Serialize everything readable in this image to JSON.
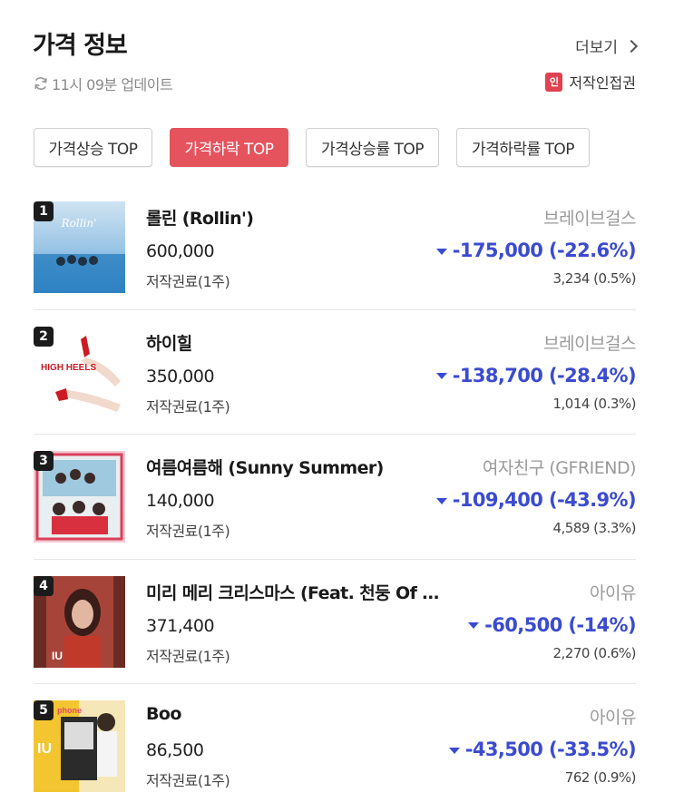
{
  "header": {
    "title": "가격 정보",
    "more_label": "더보기"
  },
  "update": {
    "text": "11시 09분 업데이트",
    "icon": "refresh-icon"
  },
  "copyright": {
    "badge": "인",
    "label": "저작인접권"
  },
  "tabs": [
    {
      "label": "가격상승 TOP",
      "active": false
    },
    {
      "label": "가격하락 TOP",
      "active": true
    },
    {
      "label": "가격상승률 TOP",
      "active": false
    },
    {
      "label": "가격하락률 TOP",
      "active": false
    }
  ],
  "items": [
    {
      "rank": "1",
      "title": "롤린 (Rollin')",
      "artist": "브레이브걸스",
      "price": "600,000",
      "unit": "저작권료(1주)",
      "change": "-175,000 (-22.6%)",
      "volume": "3,234 (0.5%)"
    },
    {
      "rank": "2",
      "title": "하이힐",
      "artist": "브레이브걸스",
      "price": "350,000",
      "unit": "저작권료(1주)",
      "change": "-138,700 (-28.4%)",
      "volume": "1,014 (0.3%)"
    },
    {
      "rank": "3",
      "title": "여름여름해 (Sunny Summer)",
      "artist": "여자친구 (GFRIEND)",
      "price": "140,000",
      "unit": "저작권료(1주)",
      "change": "-109,400 (-43.9%)",
      "volume": "4,589 (3.3%)"
    },
    {
      "rank": "4",
      "title": "미리 메리 크리스마스 (Feat. 천둥 Of …",
      "artist": "아이유",
      "price": "371,400",
      "unit": "저작권료(1주)",
      "change": "-60,500 (-14%)",
      "volume": "2,270 (0.6%)"
    },
    {
      "rank": "5",
      "title": "Boo",
      "artist": "아이유",
      "price": "86,500",
      "unit": "저작권료(1주)",
      "change": "-43,500 (-33.5%)",
      "volume": "762 (0.9%)"
    }
  ],
  "colors": {
    "accent_red": "#e5535d",
    "down_blue": "#3b4bd0",
    "muted": "#999999"
  }
}
